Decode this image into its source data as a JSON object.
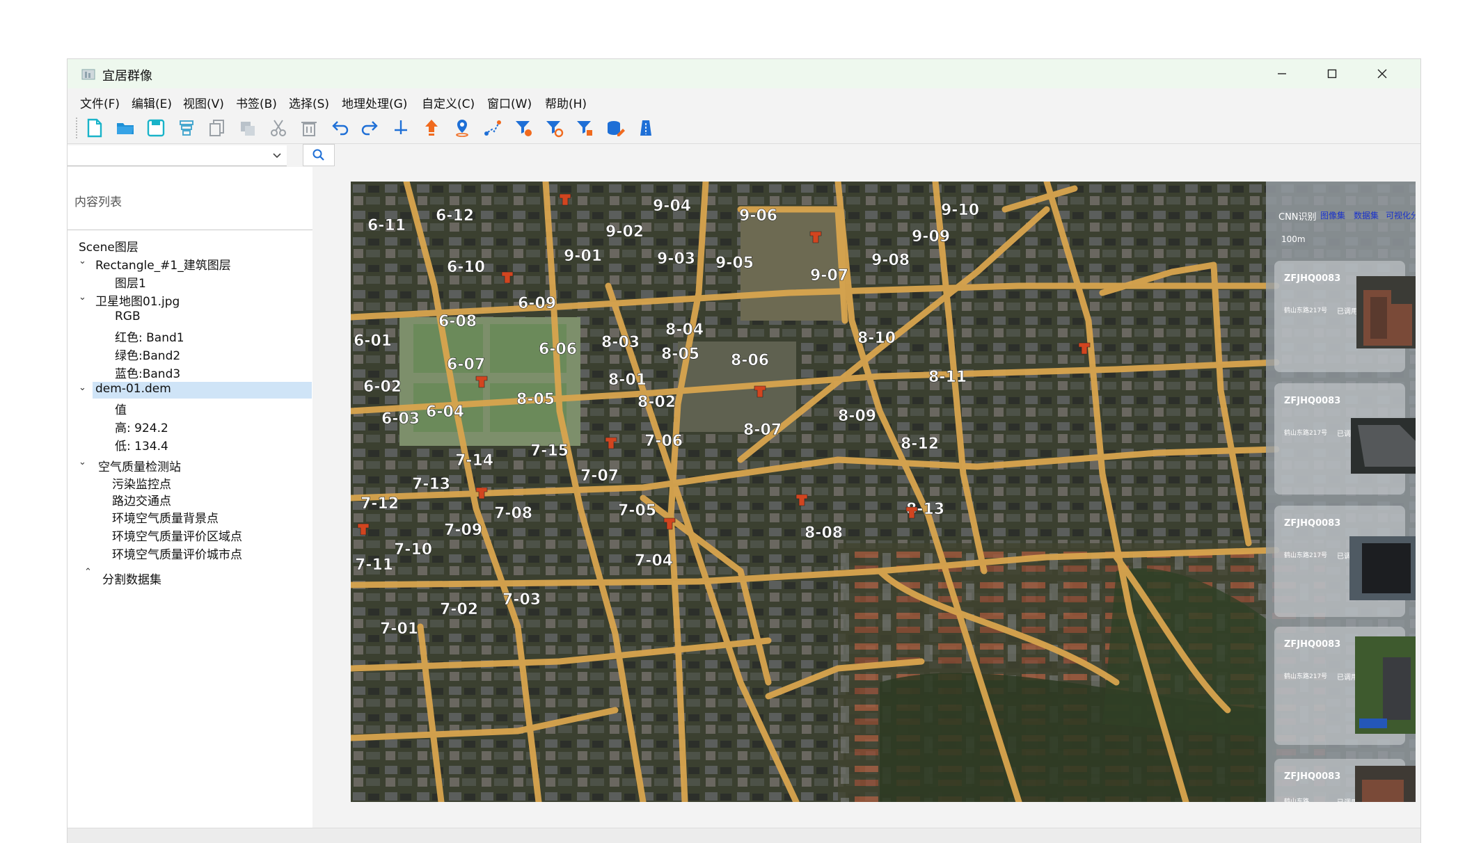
{
  "window": {
    "title": "宜居群像"
  },
  "menu": [
    "文件(F)",
    "编辑(E)",
    "视图(V)",
    "书签(B)",
    "选择(S)",
    "地理处理(G)",
    "自定义(C)",
    "窗口(W)",
    "帮助(H)"
  ],
  "toolbar_icons": [
    "new-file-icon",
    "open-folder-icon",
    "save-icon",
    "layer-stack-icon",
    "copy-icon",
    "paste-icon",
    "cut-icon",
    "delete-icon",
    "undo-icon",
    "redo-icon",
    "pin-down-icon",
    "upload-arrow-icon",
    "location-pin-icon",
    "route-icon",
    "filter-stack-icon",
    "filter-edit-icon",
    "filter-icon",
    "database-edit-icon",
    "ruler-icon"
  ],
  "search": {
    "combo_value": ""
  },
  "left_panel": {
    "header": "内容列表",
    "tree": {
      "root": "Scene图层",
      "n1": "Rectangle_#1_建筑图层",
      "n1a": "图层1",
      "n2": "卫星地图01.jpg",
      "n2a": "RGB",
      "n2b": "红色: Band1",
      "n2c": "绿色:Band2",
      "n2d": "蓝色:Band3",
      "n3": "dem-01.dem",
      "n3a": "值",
      "n3b": "高:  924.2",
      "n3c": "低:  134.4",
      "n4": "空气质量检测站",
      "n4a": "污染监控点",
      "n4b": "路边交通点",
      "n4c": "环境空气质量背景点",
      "n4d": "环境空气质量评价区域点",
      "n4e": "环境空气质量评价城市点",
      "n5": "分割数据集"
    }
  },
  "map": {
    "labels": [
      "6-11",
      "6-12",
      "9-04",
      "9-06",
      "9-10",
      "9-02",
      "9-09",
      "9-01",
      "9-03",
      "9-05",
      "9-08",
      "6-10",
      "9-07",
      "6-09",
      "6-08",
      "8-04",
      "8-10",
      "6-01",
      "8-03",
      "6-06",
      "8-05",
      "8-06",
      "6-07",
      "8-11",
      "6-02",
      "8-01",
      "8-05",
      "8-02",
      "6-04",
      "6-03",
      "8-09",
      "8-07",
      "8-12",
      "7-06",
      "7-15",
      "7-14",
      "7-07",
      "7-13",
      "8-13",
      "7-12",
      "7-05",
      "7-08",
      "7-09",
      "8-08",
      "7-10",
      "7-11",
      "7-04",
      "7-03",
      "7-02",
      "7-01"
    ]
  },
  "right_panel": {
    "tabs": [
      "CNN识别",
      "图像集",
      "数据集",
      "可视化分析"
    ],
    "scale": "100m",
    "cards": [
      {
        "id": "ZFJHQ0083",
        "addr": "鹤山东路217号",
        "status": "已调用"
      },
      {
        "id": "ZFJHQ0083",
        "addr": "鹤山东路217号",
        "status": "已调用"
      },
      {
        "id": "ZFJHQ0083",
        "addr": "鹤山东路217号",
        "status": "已调用"
      },
      {
        "id": "ZFJHQ0083",
        "addr": "鹤山东路217号",
        "status": "已调用"
      },
      {
        "id": "ZFJHQ0083",
        "addr": "鹤山东路",
        "status": "已调用"
      }
    ]
  },
  "colors": {
    "accent": "#1e90d6",
    "road": "#e0a54a",
    "selection": "#cfe4f7",
    "titlebar": "#eef8ee"
  }
}
